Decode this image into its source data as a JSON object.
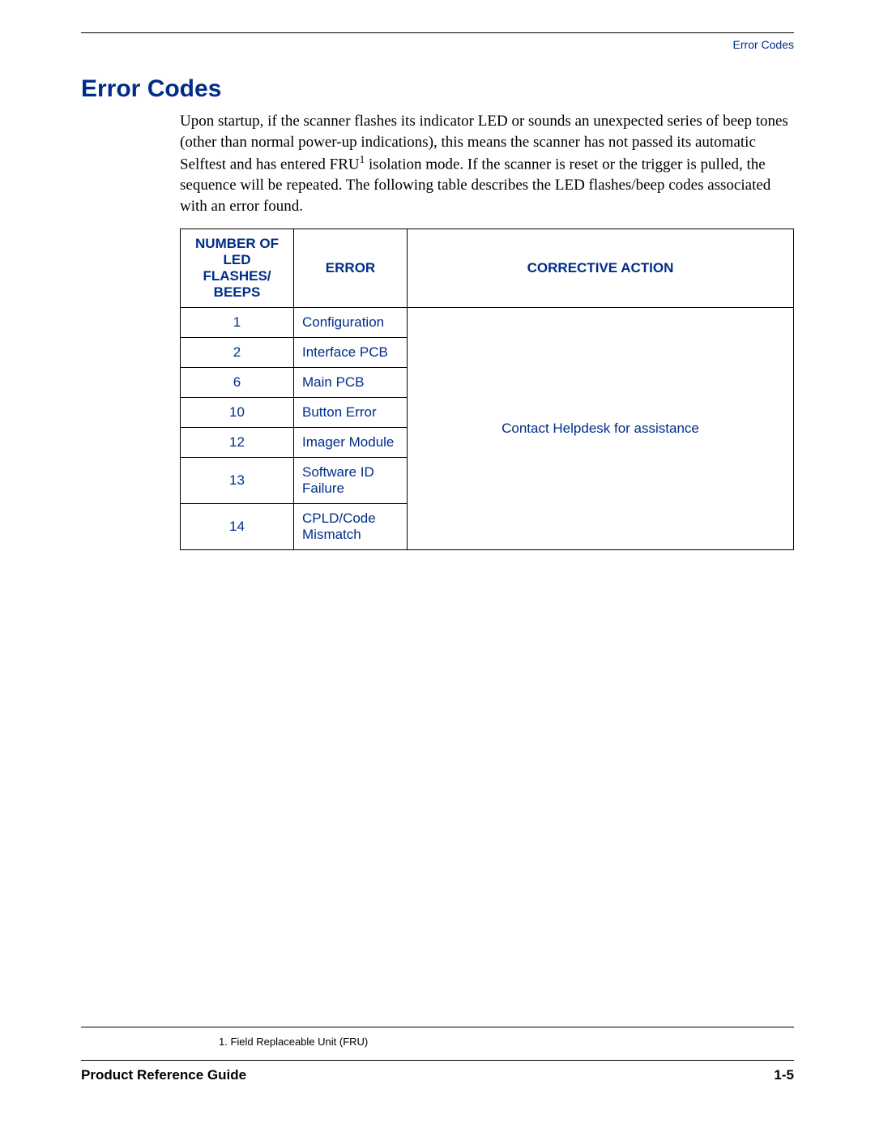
{
  "header": {
    "running_head": "Error Codes"
  },
  "title": "Error Codes",
  "intro": {
    "p1a": "Upon startup, if the scanner flashes its indicator LED or sounds an unexpected series of beep tones (other than normal power-up indications), this means the scanner has not passed its automatic Selftest and has entered FRU",
    "sup": "1",
    "p1b": " isolation mode. If the scanner is reset or the trigger is pulled, the sequence will be repeated. The following table describes the LED flashes/beep codes associated with an error found."
  },
  "table": {
    "head": {
      "col1": "Number of LED Flashes/ Beeps",
      "col2": "Error",
      "col3": "Corrective Action"
    },
    "rows": [
      {
        "n": "1",
        "err": "Configuration"
      },
      {
        "n": "2",
        "err": "Interface PCB"
      },
      {
        "n": "6",
        "err": "Main PCB"
      },
      {
        "n": "10",
        "err": "Button Error"
      },
      {
        "n": "12",
        "err": "Imager Module"
      },
      {
        "n": "13",
        "err": "Software ID Failure"
      },
      {
        "n": "14",
        "err": "CPLD/Code Mismatch"
      }
    ],
    "action": "Contact Helpdesk for assistance"
  },
  "footnote": {
    "marker": "1.",
    "text": "Field Replaceable Unit (FRU)"
  },
  "footer": {
    "left": "Product Reference Guide",
    "right": "1-5"
  }
}
